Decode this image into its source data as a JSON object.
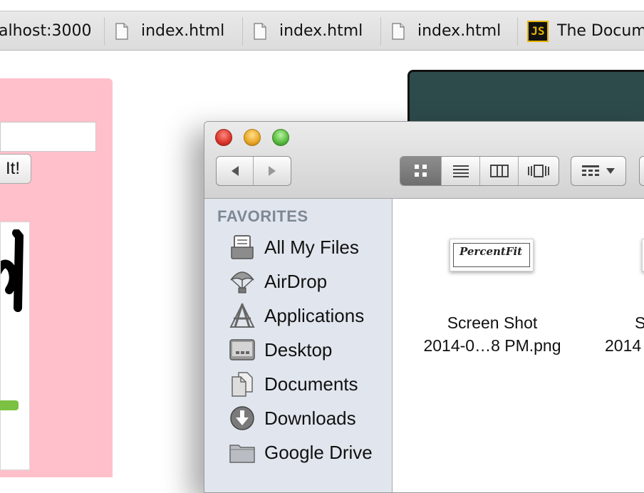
{
  "browser": {
    "tabs": [
      {
        "label": "alhost:3000",
        "icon": "none"
      },
      {
        "label": "index.html",
        "icon": "document-icon"
      },
      {
        "label": "index.html",
        "icon": "document-icon"
      },
      {
        "label": "index.html",
        "icon": "document-icon"
      },
      {
        "label": "The Docum",
        "icon": "js-favicon-icon"
      }
    ],
    "favicon_text": "JS"
  },
  "page": {
    "button_label": "It!"
  },
  "finder": {
    "sidebar": {
      "heading": "FAVORITES",
      "items": [
        {
          "label": "All My Files",
          "icon": "all-my-files-icon"
        },
        {
          "label": "AirDrop",
          "icon": "airdrop-icon"
        },
        {
          "label": "Applications",
          "icon": "applications-icon"
        },
        {
          "label": "Desktop",
          "icon": "desktop-icon"
        },
        {
          "label": "Documents",
          "icon": "documents-icon"
        },
        {
          "label": "Downloads",
          "icon": "downloads-icon"
        },
        {
          "label": "Google Drive",
          "icon": "folder-icon"
        }
      ]
    },
    "files": [
      {
        "line1": "Screen Shot",
        "line2": "2014-0…8 PM.png",
        "thumb_text": "PercentFit"
      },
      {
        "line1": "S",
        "line2": "2014"
      }
    ]
  },
  "colors": {
    "pink_panel": "#ffc0cb",
    "dark_window": "#2e4b4b",
    "sidebar_bg": "#e1e6ee",
    "progress_green": "#7cc142"
  }
}
